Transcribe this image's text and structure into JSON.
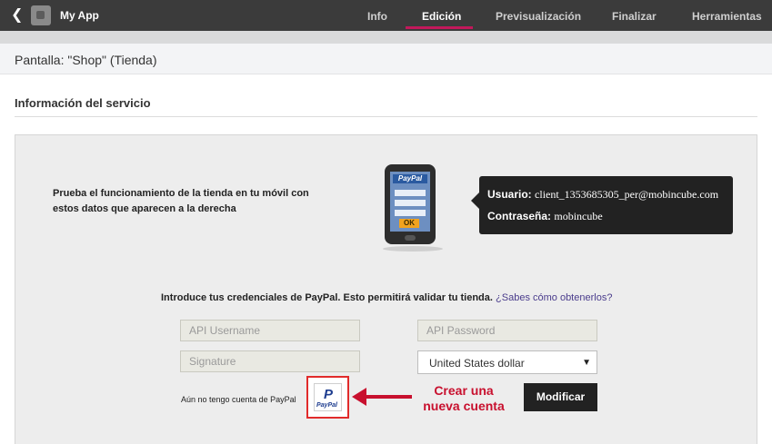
{
  "app": {
    "name": "My App"
  },
  "nav": {
    "tabs": [
      {
        "label": "Info"
      },
      {
        "label": "Edición"
      },
      {
        "label": "Previsualización"
      },
      {
        "label": "Finalizar"
      },
      {
        "label": "Herramientas"
      }
    ],
    "active_tab": "Edición"
  },
  "screen": {
    "title": "Pantalla: \"Shop\" (Tienda)"
  },
  "section": {
    "title": "Información del servicio"
  },
  "test_info": {
    "text": "Prueba el funcionamiento de la tienda en tu móvil con estos datos que aparecen a la derecha"
  },
  "phone": {
    "brand": "PayPal",
    "ok_label": "OK"
  },
  "credentials": {
    "user_label": "Usuario:",
    "user_value": "client_1353685305_per@mobincube.com",
    "password_label": "Contraseña:",
    "password_value": "mobincube"
  },
  "intro": {
    "text": "Introduce tus credenciales de PayPal. Esto permitirá validar tu tienda.",
    "link": "¿Sabes cómo obtenerlos?"
  },
  "fields": {
    "api_username_placeholder": "API Username",
    "api_password_placeholder": "API Password",
    "signature_placeholder": "Signature"
  },
  "currency": {
    "selected": "United States dollar"
  },
  "no_account": {
    "text": "Aún no tengo cuenta de PayPal"
  },
  "paypal_button": {
    "mark": "P",
    "label": "PayPal"
  },
  "annotation": {
    "line1": "Crear una",
    "line2": "nueva cuenta"
  },
  "actions": {
    "modify_label": "Modificar"
  },
  "colors": {
    "topbar": "#3b3b3b",
    "accent": "#c2185b",
    "annotation_red": "#c8102e",
    "tooltip_bg": "#222222"
  }
}
